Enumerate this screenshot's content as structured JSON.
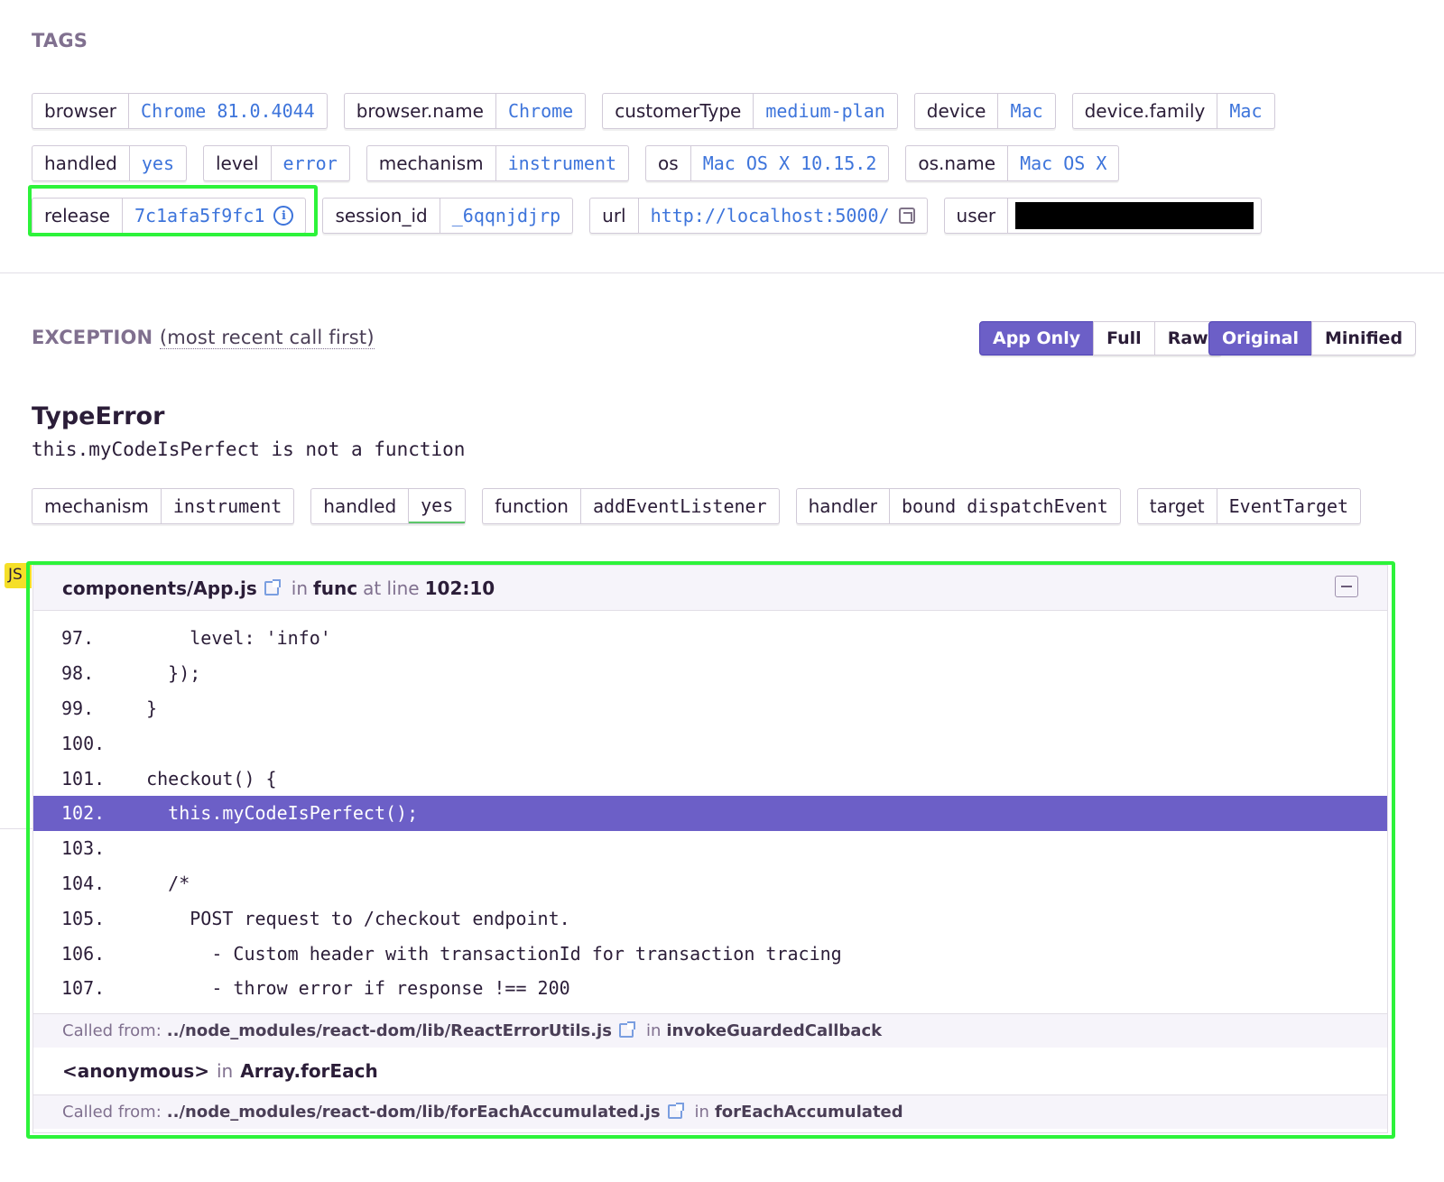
{
  "tags_section": {
    "heading": "TAGS",
    "rows": [
      [
        {
          "key": "browser",
          "value": "Chrome 81.0.4044"
        },
        {
          "key": "browser.name",
          "value": "Chrome"
        },
        {
          "key": "customerType",
          "value": "medium-plan"
        },
        {
          "key": "device",
          "value": "Mac"
        },
        {
          "key": "device.family",
          "value": "Mac"
        }
      ],
      [
        {
          "key": "handled",
          "value": "yes"
        },
        {
          "key": "level",
          "value": "error"
        },
        {
          "key": "mechanism",
          "value": "instrument"
        },
        {
          "key": "os",
          "value": "Mac OS X 10.15.2"
        },
        {
          "key": "os.name",
          "value": "Mac OS X"
        }
      ],
      [
        {
          "key": "release",
          "value": "7c1afa5f9fc1",
          "icon": "info-icon"
        },
        {
          "key": "session_id",
          "value": "_6qqnjdjrp"
        },
        {
          "key": "url",
          "value": "http://localhost:5000/",
          "icon": "external-link-icon"
        },
        {
          "key": "user",
          "value": "",
          "redacted": true
        }
      ]
    ]
  },
  "exception": {
    "heading": "EXCEPTION",
    "subheading": "(most recent call first)",
    "view_buttons": [
      "App Only",
      "Full",
      "Raw"
    ],
    "active_view": "App Only",
    "format_buttons": [
      "Original",
      "Minified"
    ],
    "active_format": "Original",
    "type": "TypeError",
    "value": "this.myCodeIsPerfect is not a function",
    "mechanism_tags": [
      {
        "key": "mechanism",
        "value": "instrument"
      },
      {
        "key": "handled",
        "value": "yes"
      },
      {
        "key": "function",
        "value": "addEventListener"
      },
      {
        "key": "handler",
        "value": "bound dispatchEvent"
      },
      {
        "key": "target",
        "value": "EventTarget"
      }
    ]
  },
  "frame": {
    "platform_badge": "JS",
    "filename": "components/App.js",
    "in_label": "in",
    "function": "func",
    "at_line_label": "at line",
    "line_col": "102:10",
    "code_lines": [
      {
        "num": "97.",
        "text": "      level: 'info'"
      },
      {
        "num": "98.",
        "text": "    });"
      },
      {
        "num": "99.",
        "text": "  }"
      },
      {
        "num": "100.",
        "text": ""
      },
      {
        "num": "101.",
        "text": "  checkout() {"
      },
      {
        "num": "102.",
        "text": "    this.myCodeIsPerfect();",
        "active": true
      },
      {
        "num": "103.",
        "text": ""
      },
      {
        "num": "104.",
        "text": "    /*"
      },
      {
        "num": "105.",
        "text": "      POST request to /checkout endpoint."
      },
      {
        "num": "106.",
        "text": "        - Custom header with transactionId for transaction tracing"
      },
      {
        "num": "107.",
        "text": "        - throw error if response !== 200"
      }
    ],
    "called_from_1": {
      "label": "Called from:",
      "file": "../node_modules/react-dom/lib/ReactErrorUtils.js",
      "in_label": "in",
      "function": "invokeGuardedCallback"
    },
    "anon_frame": {
      "name": "<anonymous>",
      "in_label": "in",
      "function": "Array.forEach"
    },
    "called_from_2": {
      "label": "Called from:",
      "file": "../node_modules/react-dom/lib/forEachAccumulated.js",
      "in_label": "in",
      "function": "forEachAccumulated"
    }
  }
}
